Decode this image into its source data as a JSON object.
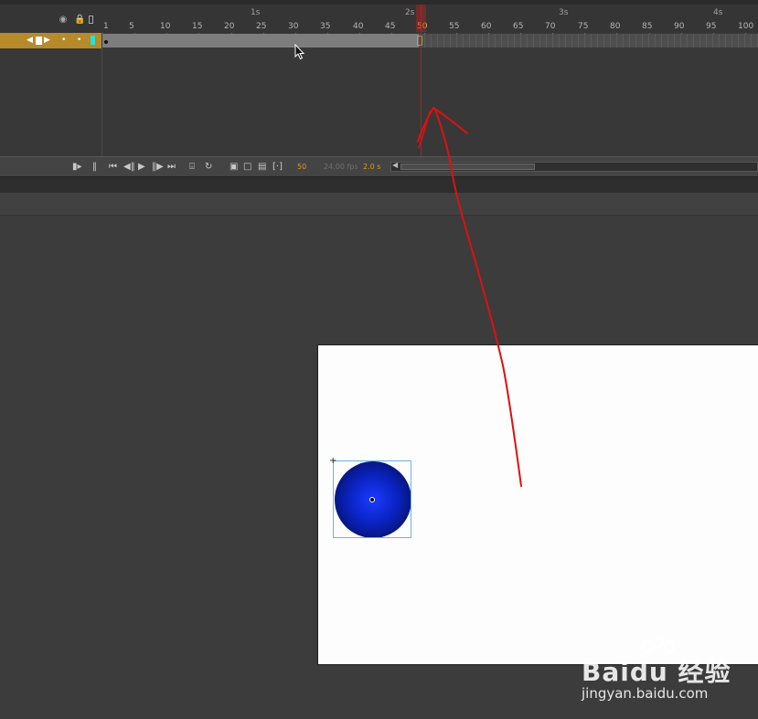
{
  "timeline": {
    "header_icons": [
      "eye-icon",
      "lock-icon",
      "outline-icon"
    ],
    "seconds": [
      "1s",
      "2s",
      "3s",
      "4s"
    ],
    "frames": [
      "1",
      "5",
      "10",
      "15",
      "20",
      "25",
      "30",
      "35",
      "40",
      "45",
      "50",
      "55",
      "60",
      "65",
      "70",
      "75",
      "80",
      "85",
      "90",
      "95",
      "100"
    ],
    "current_frame_label": "50",
    "layer": {
      "icons": [
        "arrows-icon",
        "layer-icon",
        "dot-icon",
        "dot-icon",
        "color-swatch-icon"
      ],
      "color": "#b78a2a",
      "swatch_color": "#26e0d0"
    },
    "controls": {
      "fps_text": "24.00 fps",
      "current_frame": "50",
      "elapsed_time": "2.0 s"
    }
  },
  "stage": {
    "background": "#fdfdfd",
    "shape": "circle",
    "shape_fill": "#0a22c0"
  },
  "annotation": {
    "color": "#e01010",
    "shape": "arrow"
  },
  "watermark": {
    "brand": "Baidu 经验",
    "url": "jingyan.baidu.com"
  },
  "colors": {
    "ui_bg": "#3c3c3c",
    "accent_orange": "#d79a2a",
    "playhead": "#b02020"
  }
}
